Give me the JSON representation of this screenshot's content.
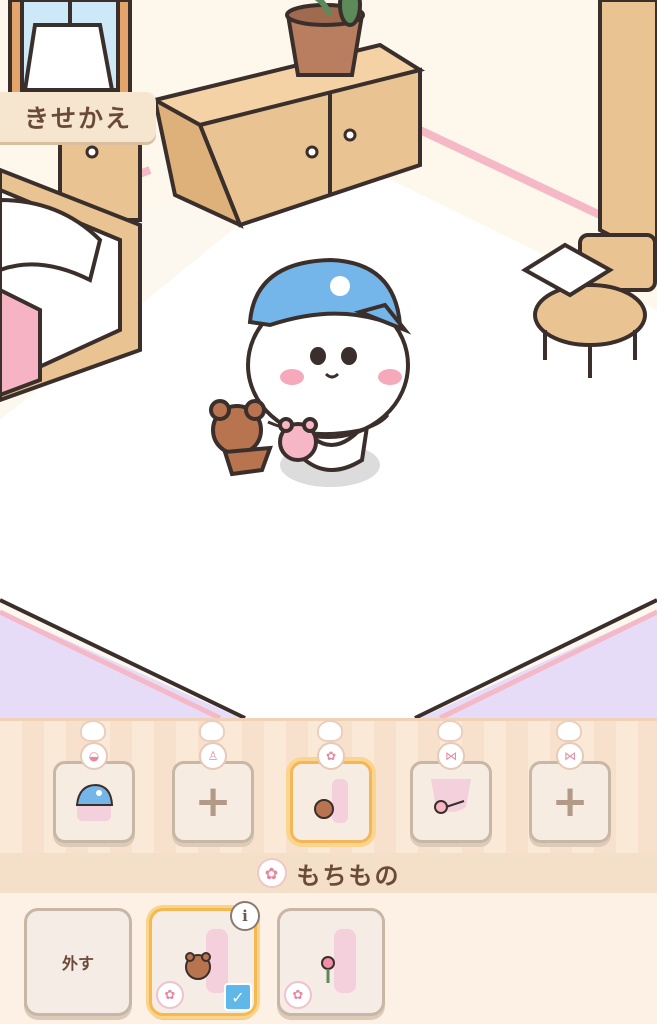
{
  "header": {
    "title": "きせかえ"
  },
  "equip_slots": [
    {
      "icon": "hat-slot-icon",
      "state": "equipped"
    },
    {
      "icon": "shirt-slot-icon",
      "state": "empty",
      "plus": "+"
    },
    {
      "icon": "flower-slot-icon",
      "state": "equipped-selected"
    },
    {
      "icon": "ribbon-slot-icon",
      "state": "equipped"
    },
    {
      "icon": "ribbon-slot-icon",
      "state": "empty",
      "plus": "+"
    }
  ],
  "inventory": {
    "section_title": "もちもの",
    "section_icon": "flower-icon",
    "remove_label": "外す",
    "info_symbol": "i",
    "check_symbol": "✓",
    "items": [
      {
        "name": "bear-pouch",
        "selected": true
      },
      {
        "name": "flower-pouch",
        "selected": false
      }
    ]
  },
  "colors": {
    "accent": "#f5b94f",
    "check": "#5fb8e8",
    "brown": "#6b4a3a"
  }
}
